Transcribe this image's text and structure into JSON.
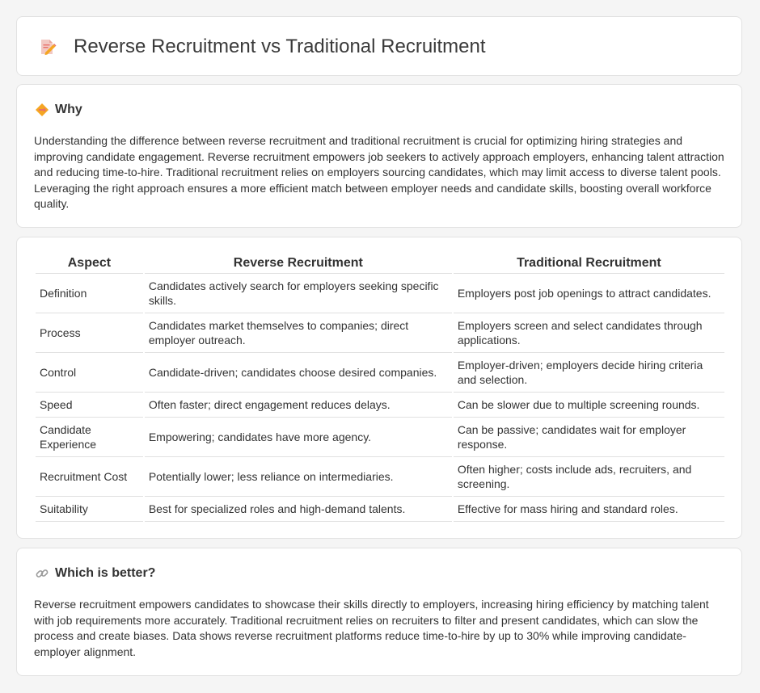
{
  "header": {
    "title": "Reverse Recruitment vs Traditional Recruitment"
  },
  "why": {
    "title": "Why",
    "text": "Understanding the difference between reverse recruitment and traditional recruitment is crucial for optimizing hiring strategies and improving candidate engagement. Reverse recruitment empowers job seekers to actively approach employers, enhancing talent attraction and reducing time-to-hire. Traditional recruitment relies on employers sourcing candidates, which may limit access to diverse talent pools. Leveraging the right approach ensures a more efficient match between employer needs and candidate skills, boosting overall workforce quality."
  },
  "table": {
    "headers": [
      "Aspect",
      "Reverse Recruitment",
      "Traditional Recruitment"
    ],
    "rows": [
      {
        "aspect": "Definition",
        "reverse": "Candidates actively search for employers seeking specific skills.",
        "traditional": "Employers post job openings to attract candidates."
      },
      {
        "aspect": "Process",
        "reverse": "Candidates market themselves to companies; direct employer outreach.",
        "traditional": "Employers screen and select candidates through applications."
      },
      {
        "aspect": "Control",
        "reverse": "Candidate-driven; candidates choose desired companies.",
        "traditional": "Employer-driven; employers decide hiring criteria and selection."
      },
      {
        "aspect": "Speed",
        "reverse": "Often faster; direct engagement reduces delays.",
        "traditional": "Can be slower due to multiple screening rounds."
      },
      {
        "aspect": "Candidate Experience",
        "reverse": "Empowering; candidates have more agency.",
        "traditional": "Can be passive; candidates wait for employer response."
      },
      {
        "aspect": "Recruitment Cost",
        "reverse": "Potentially lower; less reliance on intermediaries.",
        "traditional": "Often higher; costs include ads, recruiters, and screening."
      },
      {
        "aspect": "Suitability",
        "reverse": "Best for specialized roles and high-demand talents.",
        "traditional": "Effective for mass hiring and standard roles."
      }
    ]
  },
  "better": {
    "title": "Which is better?",
    "text": "Reverse recruitment empowers candidates to showcase their skills directly to employers, increasing hiring efficiency by matching talent with job requirements more accurately. Traditional recruitment relies on recruiters to filter and present candidates, which can slow the process and create biases. Data shows reverse recruitment platforms reduce time-to-hire by up to 30% while improving candidate-employer alignment."
  },
  "icons": {
    "title": "document-pencil-icon",
    "why": "diamond-warning-icon",
    "better": "link-icon"
  },
  "colors": {
    "background": "#f5f5f5",
    "card": "#ffffff",
    "accent_orange": "#f5a623",
    "accent_pink": "#e8706a"
  }
}
